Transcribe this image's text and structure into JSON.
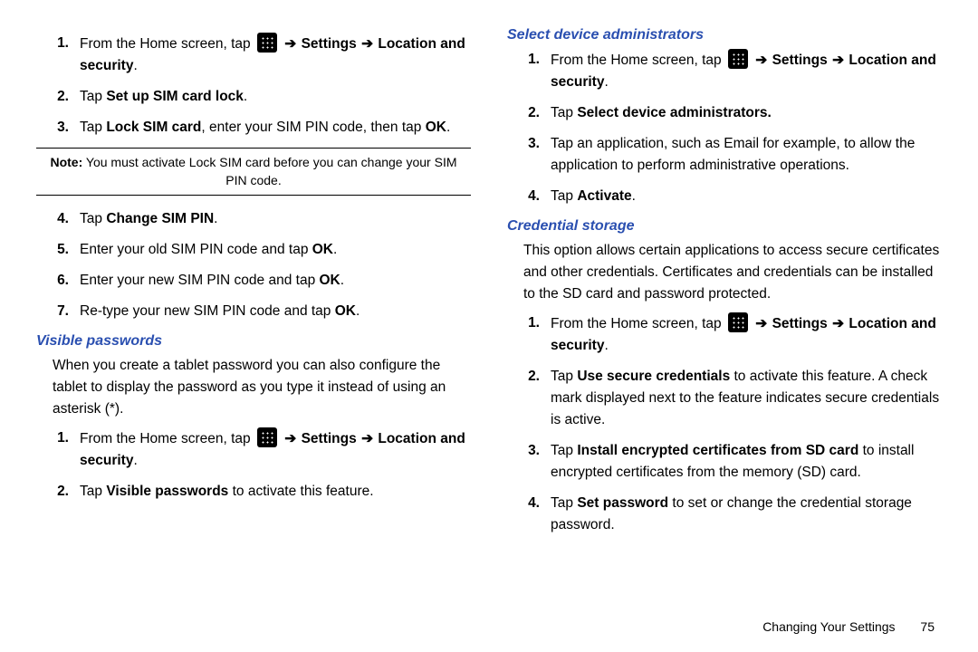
{
  "arrow": "➔",
  "leftCol": {
    "steps1": [
      {
        "n": "1.",
        "text_pre": "From the Home screen, tap ",
        "icon": true,
        "text_post": " ",
        "bold1": "Settings",
        "mid": " ",
        "bold2": "Location and security",
        "tail": "."
      },
      {
        "n": "2.",
        "plain": "Tap ",
        "bold": "Set up SIM card lock",
        "tail": "."
      },
      {
        "n": "3.",
        "plain": "Tap ",
        "bold": "Lock SIM card",
        "mid": ", enter your SIM PIN code, then tap ",
        "bold2": "OK",
        "tail": "."
      }
    ],
    "note_label": "Note:",
    "note_text": " You must activate Lock SIM card before you can change your SIM PIN code.",
    "steps2": [
      {
        "n": "4.",
        "plain": "Tap ",
        "bold": "Change SIM PIN",
        "tail": "."
      },
      {
        "n": "5.",
        "plain": "Enter your old SIM PIN code and tap ",
        "bold": "OK",
        "tail": "."
      },
      {
        "n": "6.",
        "plain": "Enter your new SIM PIN code and tap ",
        "bold": "OK",
        "tail": "."
      },
      {
        "n": "7.",
        "plain": "Re-type your new SIM PIN code and tap ",
        "bold": "OK",
        "tail": "."
      }
    ],
    "heading_visible": "Visible passwords",
    "visible_para": "When you create a tablet password you can also configure the tablet to display the password as you type it instead of using an asterisk (*).",
    "steps3": [
      {
        "n": "1.",
        "nav": true
      },
      {
        "n": "2.",
        "plain": "Tap ",
        "bold": "Visible passwords",
        "tail": " to activate this feature."
      }
    ]
  },
  "rightCol": {
    "heading_admin": "Select device administrators",
    "admin_steps": [
      {
        "n": "1.",
        "nav": true
      },
      {
        "n": "2.",
        "plain": "Tap ",
        "bold": "Select device administrators.",
        "tail": ""
      },
      {
        "n": "3.",
        "plain": "Tap an application, such as Email for example, to allow the application to perform administrative operations.",
        "bold": "",
        "tail": ""
      },
      {
        "n": "4.",
        "plain": "Tap ",
        "bold": "Activate",
        "tail": "."
      }
    ],
    "heading_cred": "Credential storage",
    "cred_para": "This option allows certain applications to access secure certificates and other credentials. Certificates and credentials can be installed to the SD card and password protected.",
    "cred_steps": [
      {
        "n": "1.",
        "nav": true
      },
      {
        "n": "2.",
        "plain": "Tap ",
        "bold": "Use secure credentials",
        "tail": " to activate this feature. A check mark displayed next to the feature indicates secure credentials is active."
      },
      {
        "n": "3.",
        "plain": "Tap ",
        "bold": "Install encrypted certificates from SD card",
        "tail": " to install encrypted certificates from the memory (SD) card."
      },
      {
        "n": "4.",
        "plain": "Tap ",
        "bold": "Set password",
        "tail": " to set or change the credential storage password."
      }
    ]
  },
  "nav_template": {
    "pre": "From the Home screen, tap ",
    "settings": "Settings",
    "loc": "Location and security",
    "tail": "."
  },
  "footer": {
    "section": "Changing Your Settings",
    "page": "75"
  }
}
